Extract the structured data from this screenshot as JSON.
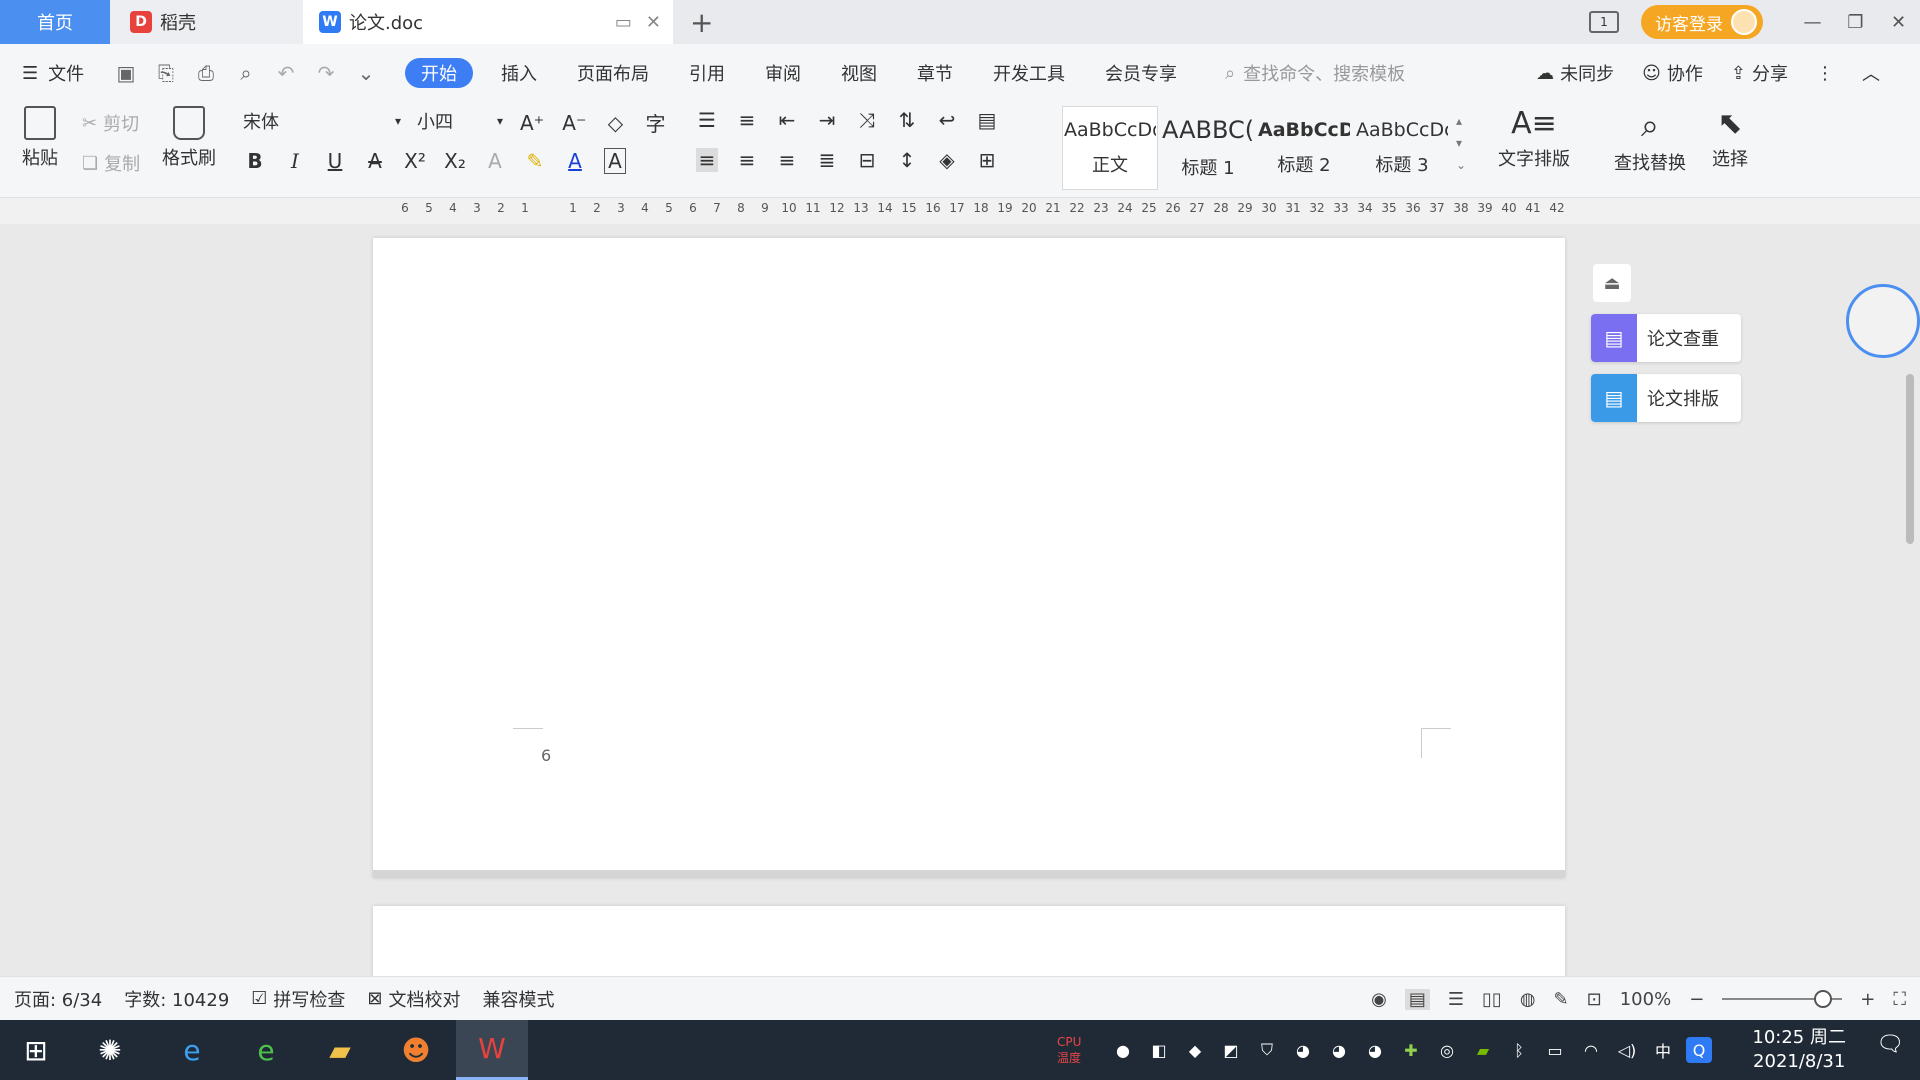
{
  "tabs": {
    "home": "首页",
    "daoke": "稻壳",
    "doc": "论文.doc"
  },
  "titlebar": {
    "layout_label": "1",
    "visitor_login": "访客登录"
  },
  "menu": {
    "file": "文件",
    "tabs": [
      "开始",
      "插入",
      "页面布局",
      "引用",
      "审阅",
      "视图",
      "章节",
      "开发工具",
      "会员专享"
    ],
    "search_placeholder": "查找命令、搜索模板",
    "right": [
      "未同步",
      "协作",
      "分享"
    ]
  },
  "ribbon": {
    "paste": "粘贴",
    "cut": "剪切",
    "copy": "复制",
    "format_painter": "格式刷",
    "font_name": "宋体",
    "font_size": "小四",
    "styles": [
      {
        "sample": "AaBbCcDd",
        "name": "正文"
      },
      {
        "sample": "AABBC(",
        "name": "标题 1"
      },
      {
        "sample": "AaBbCcD",
        "name": "标题 2"
      },
      {
        "sample": "AaBbCcDc",
        "name": "标题 3"
      }
    ],
    "text_layout": "文字排版",
    "find_replace": "查找替换",
    "select": "选择"
  },
  "ruler": {
    "ticks": [
      "6",
      "5",
      "4",
      "3",
      "2",
      "1",
      "",
      "1",
      "2",
      "3",
      "4",
      "5",
      "6",
      "7",
      "8",
      "9",
      "10",
      "11",
      "12",
      "13",
      "14",
      "15",
      "16",
      "17",
      "18",
      "19",
      "20",
      "21",
      "22",
      "23",
      "24",
      "25",
      "26",
      "27",
      "28",
      "29",
      "30",
      "31",
      "32",
      "33",
      "34",
      "35",
      "36",
      "37",
      "38",
      "39",
      "40",
      "41",
      "42"
    ]
  },
  "document": {
    "page_number": "6"
  },
  "side_panel": {
    "check": "论文查重",
    "layout": "论文排版"
  },
  "status": {
    "page": "页面: 6/34",
    "words": "字数: 10429",
    "spell": "拼写检查",
    "proof": "文档校对",
    "compat": "兼容模式",
    "zoom": "100%"
  },
  "taskbar": {
    "cpu": "CPU温度",
    "ime": "中",
    "time": "10:25 周二",
    "date": "2021/8/31"
  },
  "colors": {
    "accent": "#3d7ef5",
    "home_tab": "#4b8ff0",
    "visitor": "#f5a623",
    "taskbar": "#1f2a36"
  }
}
